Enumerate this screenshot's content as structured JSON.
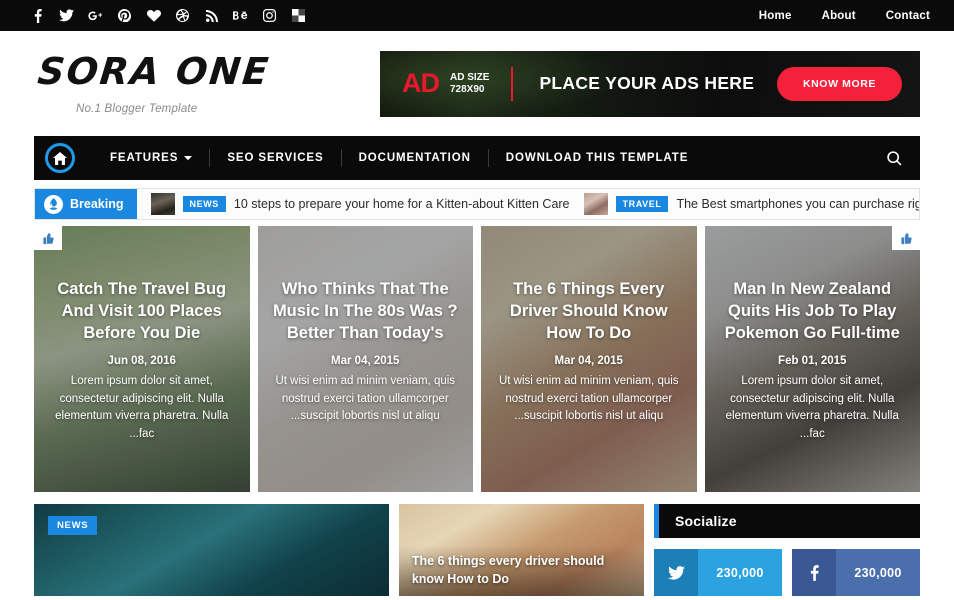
{
  "topbar": {
    "social_icons": [
      {
        "name": "facebook-icon"
      },
      {
        "name": "twitter-icon"
      },
      {
        "name": "google-plus-icon"
      },
      {
        "name": "pinterest-icon"
      },
      {
        "name": "bloglovin-heart-icon"
      },
      {
        "name": "dribbble-icon"
      },
      {
        "name": "rss-icon"
      },
      {
        "name": "behance-icon"
      },
      {
        "name": "instagram-icon"
      },
      {
        "name": "vk-icon"
      }
    ],
    "nav": [
      {
        "label": "Home"
      },
      {
        "label": "About"
      },
      {
        "label": "Contact"
      }
    ]
  },
  "header": {
    "logo_title": "SORA ONE",
    "logo_tagline": "No.1 Blogger Template",
    "ad": {
      "badge": "AD",
      "size_line1": "AD SIZE",
      "size_line2": "728X90",
      "headline": "PLACE YOUR ADS HERE",
      "button": "KNOW MORE"
    }
  },
  "mainnav": {
    "home_icon": "home-icon",
    "items": [
      {
        "label": "FEATURES",
        "has_caret": true
      },
      {
        "label": "SEO SERVICES",
        "has_caret": false
      },
      {
        "label": "DOCUMENTATION",
        "has_caret": false
      },
      {
        "label": "DOWNLOAD THIS TEMPLATE",
        "has_caret": false
      }
    ],
    "search_icon": "search-icon"
  },
  "breaking": {
    "label": "Breaking",
    "items": [
      {
        "tag": "NEWS",
        "text": "10 steps to prepare your home for a Kitten-about Kitten Care"
      },
      {
        "tag": "TRAVEL",
        "text": "The Best smartphones you can purchase right now in"
      }
    ]
  },
  "featured": [
    {
      "title": "Catch The Travel Bug And Visit 100 Places Before You Die",
      "date": "Jun 08, 2016",
      "snippet": "Lorem ipsum dolor sit amet, consectetur adipiscing elit. Nulla elementum viverra pharetra. Nulla ...fac",
      "badge": "thumbs-up-icon",
      "badge_side": "left"
    },
    {
      "title": "Who Thinks That The Music In The 80s Was ?Better Than Today's",
      "date": "Mar 04, 2015",
      "snippet": "Ut wisi enim ad minim veniam, quis nostrud exerci tation ullamcorper ...suscipit lobortis nisl ut aliqu",
      "badge": null,
      "badge_side": null
    },
    {
      "title": "The 6 Things Every Driver Should Know How To Do",
      "date": "Mar 04, 2015",
      "snippet": "Ut wisi enim ad minim veniam, quis nostrud exerci tation ullamcorper ...suscipit lobortis nisl ut aliqu",
      "badge": null,
      "badge_side": null
    },
    {
      "title": "Man In New Zealand Quits His Job To Play Pokemon Go Full-time",
      "date": "Feb 01, 2015",
      "snippet": "Lorem ipsum dolor sit amet, consectetur adipiscing elit. Nulla elementum viverra pharetra. Nulla ...fac",
      "badge": "thumbs-up-icon",
      "badge_side": "right"
    }
  ],
  "bottom_posts": [
    {
      "tag": "NEWS",
      "title": ""
    },
    {
      "tag": null,
      "title": "The 6 things every driver should know How to Do"
    }
  ],
  "sidebar": {
    "widget_title": "Socialize",
    "socials": [
      {
        "name": "twitter",
        "icon": "twitter-icon",
        "count": "230,000"
      },
      {
        "name": "facebook",
        "icon": "facebook-icon",
        "count": "230,000"
      }
    ]
  },
  "colors": {
    "accent_blue": "#1a87e0",
    "nav_blue": "#1f9ae8",
    "ad_red": "#f4213a",
    "black": "#0a0a0a",
    "twitter_blue": "#2aa3e0",
    "facebook_blue": "#4b6ead"
  }
}
